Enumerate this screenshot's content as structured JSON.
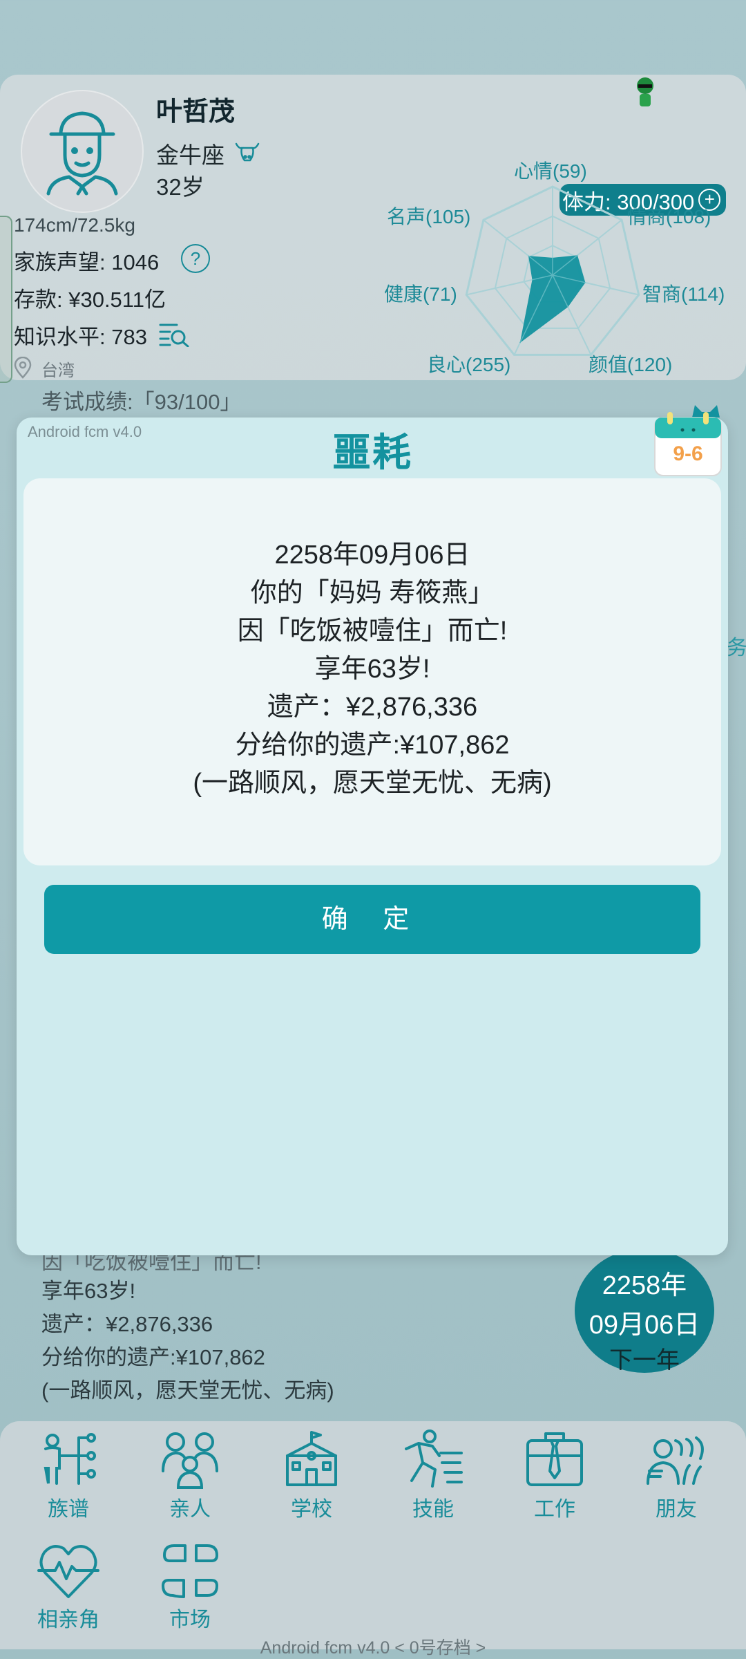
{
  "profile": {
    "name": "叶哲茂",
    "zodiac": "金牛座",
    "age": "32岁",
    "height_weight": "174cm/72.5kg",
    "family_reputation": "家族声望: 1046",
    "savings": "存款: ¥30.511亿",
    "knowledge": "知识水平: 783",
    "location": "台湾",
    "stamina": "体力: 300/300",
    "exam_score": "考试成绩:「93/100」"
  },
  "radar": {
    "labels": {
      "mood": "心情(59)",
      "eq": "情商(108)",
      "iq": "智商(114)",
      "looks": "颜值(120)",
      "conscience": "良心(255)",
      "health": "健康(71)",
      "fame": "名声(105)"
    },
    "values": {
      "mood": 59,
      "eq": 108,
      "iq": 114,
      "looks": 120,
      "conscience": 255,
      "health": 71,
      "fame": 105
    },
    "max": 300,
    "fill_color": "#13929f"
  },
  "modal": {
    "version": "Android fcm v4.0",
    "title": "噩耗",
    "calendar_date": "9-6",
    "lines": [
      "2258年09月06日",
      "你的「妈妈 寿筱燕」",
      "因「吃饭被噎住」而亡!",
      "享年63岁!",
      "遗产：¥2,876,336",
      "分给你的遗产:¥107,862",
      "(一路顺风，愿天堂无忧、无病)"
    ],
    "confirm": "确 定"
  },
  "log": {
    "partial": "因「吃饭被噎住」而亡!",
    "lines": [
      "享年63岁!",
      "遗产：¥2,876,336",
      "分给你的遗产:¥107,862",
      "(一路顺风，愿天堂无忧、无病)"
    ]
  },
  "date_bubble": {
    "year": "2258年",
    "date": "09月06日",
    "next": "下一年"
  },
  "nav": [
    {
      "label": "族谱",
      "icon": "family-tree-icon"
    },
    {
      "label": "亲人",
      "icon": "relatives-icon"
    },
    {
      "label": "学校",
      "icon": "school-icon"
    },
    {
      "label": "技能",
      "icon": "skills-icon"
    },
    {
      "label": "工作",
      "icon": "work-icon"
    },
    {
      "label": "朋友",
      "icon": "friends-icon"
    },
    {
      "label": "相亲角",
      "icon": "dating-icon"
    },
    {
      "label": "市场",
      "icon": "market-icon"
    }
  ],
  "footer": "Android fcm v4.0  < 0号存档 >",
  "side_glyph": "务",
  "colors": {
    "accent": "#13929f",
    "button": "#0f9aa6",
    "modal_bg": "#cfebee"
  }
}
